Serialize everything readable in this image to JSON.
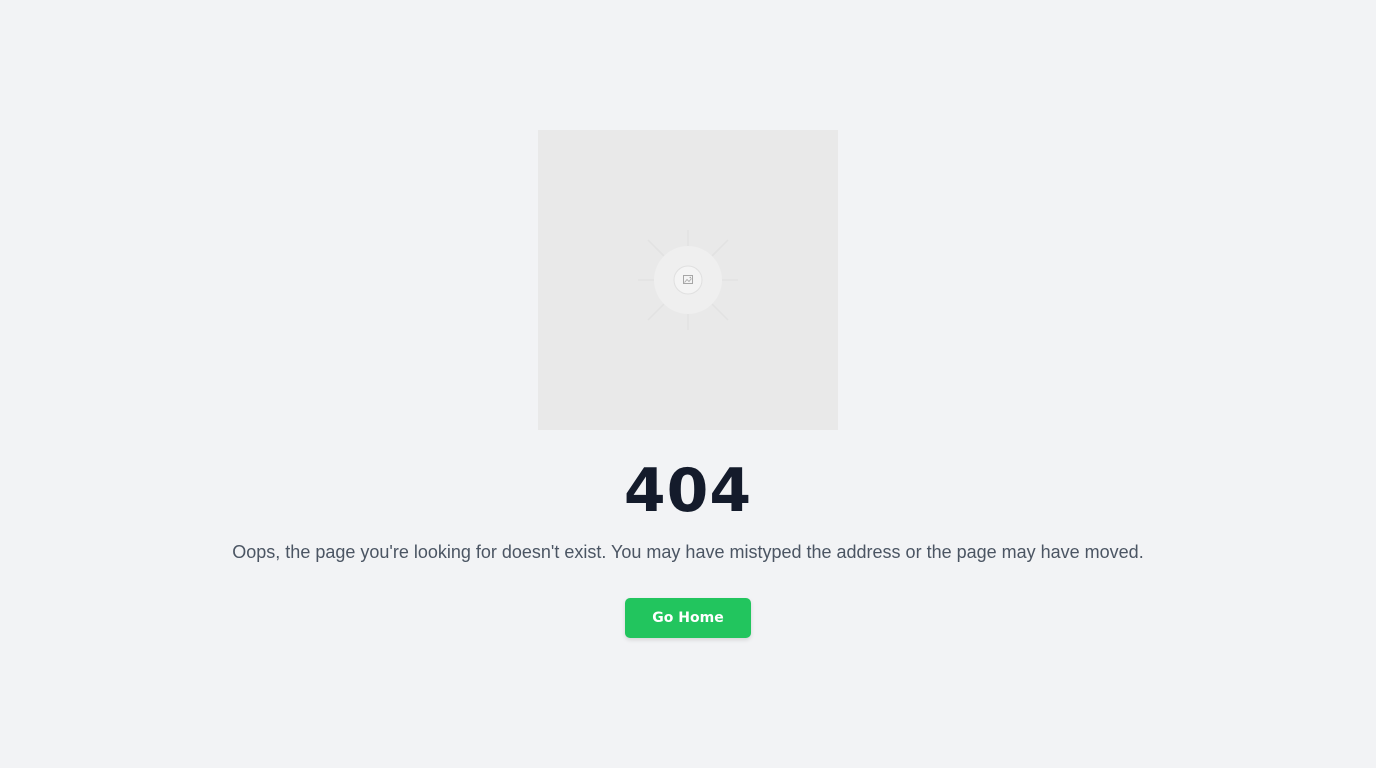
{
  "error": {
    "code": "404",
    "message": "Oops, the page you're looking for doesn't exist. You may have mistyped the address or the page may have moved."
  },
  "actions": {
    "home_label": "Go Home"
  },
  "illustration": {
    "icon": "image-placeholder-icon"
  },
  "colors": {
    "background": "#f2f3f5",
    "placeholder": "#e9e9e9",
    "heading": "#141b2b",
    "body_text": "#4b5563",
    "accent": "#22c55e"
  }
}
